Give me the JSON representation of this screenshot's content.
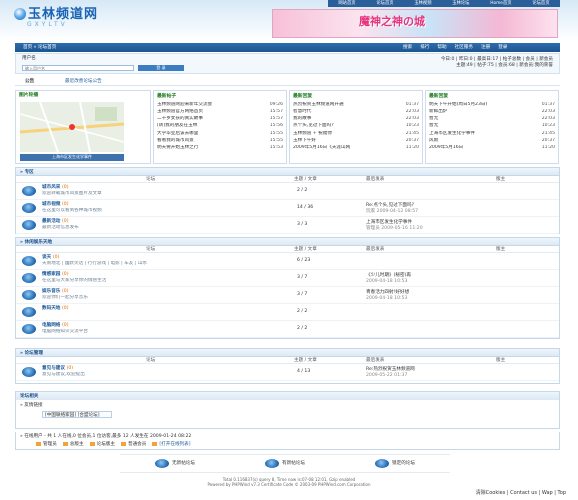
{
  "logo": {
    "text": "玉林频道网",
    "sub": "GXYLTV"
  },
  "topnav": [
    "网站首页",
    "论坛首页",
    "玉林视频",
    "玉林论坛",
    "Home首页",
    "论坛首页"
  ],
  "banner": {
    "text": "魔神之神の城"
  },
  "nav": {
    "left": "首页 » 论坛首页",
    "right": [
      "搜索",
      "排行",
      "帮助",
      "社区服务",
      "注册",
      "登录"
    ]
  },
  "user": {
    "label": "用户名",
    "input_placeholder": "输入用户名",
    "btn": "登 录",
    "stats": [
      "今日:0 | 昨日:0 | 最高日:17 | 帖子总数 | 会员 | 新会员",
      "主题:49 | 帖子:75 | 会员:68 | 新会员:我的荣誉"
    ]
  },
  "notice": {
    "title": "公告",
    "content": "最近改善论坛公告"
  },
  "pic": {
    "title": "图片轮播",
    "caption": "上海市区发生化学事件"
  },
  "col2": {
    "title": "最新帖子",
    "rows": [
      [
        "玉林频道网迎来新年交流会",
        "09:26"
      ],
      [
        "玉林频道官方网络首页",
        "15:57"
      ],
      [
        "二十岁女孩的真实故事",
        "15:57"
      ],
      [
        "[转]我的朋友在玉林",
        "15:56"
      ],
      [
        "大学毕业后该去哪里",
        "15:55"
      ],
      [
        "看看我的城市风景",
        "15:55"
      ],
      [
        "明天要开始玉林之行",
        "15:53"
      ]
    ]
  },
  "col3": {
    "title": "最新回复",
    "rows": [
      [
        "热烈祝贺玉林频道网开通",
        "01:37"
      ],
      [
        "智慧时代",
        "22:03"
      ],
      [
        "我的故事",
        "22:03"
      ],
      [
        "点个头,见过下面吗?",
        "10:23"
      ],
      [
        "玉林频道 + 祝福你",
        "21:45"
      ],
      [
        "玉林下午好",
        "20:37"
      ],
      [
        "2009年5月16日《天涯山网",
        "11:20"
      ]
    ]
  },
  "col4": {
    "title": "最新回复",
    "rows": [
      [
        "明天下午开始(周日5月23日)",
        "01:37"
      ],
      [
        "新鲜出炉",
        "22:03"
      ],
      [
        "暂无",
        "22:03"
      ],
      [
        "暂无",
        "10:23"
      ],
      [
        "上海市区发生化学事件",
        "21:45"
      ],
      [
        "风雨",
        "20:37"
      ],
      [
        "2009年5月16日",
        "11:20"
      ]
    ]
  },
  "sec1": {
    "title": "» 专区",
    "cols": [
      "论坛",
      "主题 / 文章",
      "最后发表",
      "版主"
    ],
    "rows": [
      {
        "name": "城市风采",
        "new": "(0)",
        "desc": "欢迎转载城市风景图片及文章",
        "stats": "2 / 2",
        "last": "",
        "lastsub": ""
      },
      {
        "name": "城市视频",
        "new": "(0)",
        "desc": "在这里可以看到各种城市视频",
        "stats": "14 / 36",
        "last": "Re:点个头,见过下面吗?",
        "lastsub": "玩家 2009-04-12 08:57"
      },
      {
        "name": "最新活动",
        "new": "(0)",
        "desc": "最新活动信息发布",
        "stats": "3 / 3",
        "last": "上海市区发生化学事件",
        "lastsub": "管理员 2009-05-16 11:20"
      }
    ]
  },
  "sec2": {
    "title": "» 休闲娱乐天地",
    "cols": [
      "论坛",
      "主题 / 文章",
      "最后发表",
      "版主"
    ],
    "rows": [
      {
        "name": "谈天",
        "new": "(0)",
        "desc": "天南地北 | 幽默笑话 | 行行游戏 | 电影 | 车友 | 山水",
        "stats": "6 / 23",
        "last": "",
        "lastsub": ""
      },
      {
        "name": "情感家园",
        "new": "(0)",
        "desc": "在这里与大家分享你的情感生活",
        "stats": "3 / 7",
        "last": "《少儿时期》(秘密)再",
        "lastsub": "2009-04-18 10:53"
      },
      {
        "name": "娱乐音乐",
        "new": "(0)",
        "desc": "欢迎你们一起分享音乐",
        "stats": "3 / 7",
        "last": "青春活力四射!好好想",
        "lastsub": "2009-04-18 10:53"
      },
      {
        "name": "数码天地",
        "new": "(0)",
        "desc": "",
        "stats": "2 / 2",
        "last": "",
        "lastsub": ""
      },
      {
        "name": "电脑网络",
        "new": "(0)",
        "desc": "电脑网络知识交流平台",
        "stats": "2 / 2",
        "last": "",
        "lastsub": ""
      }
    ]
  },
  "sec3": {
    "title": "» 论坛管理",
    "cols": [
      "论坛",
      "主题 / 文章",
      "最后发表",
      "版主"
    ],
    "rows": [
      {
        "name": "意见与建议",
        "new": "(0)",
        "desc": "意见与建议,欢迎提出",
        "stats": "4 / 13",
        "last": "Re:热烈祝贺玉林频道网",
        "lastsub": "2009-05-22 01:37"
      }
    ]
  },
  "links": {
    "title": "论坛相关",
    "sub": "» 友情链接",
    "box": "[中国联络家园] [合盟论坛]"
  },
  "online": {
    "title": "» 在线用户 - 共 1 人在线,0 位会员,1 位访客,最多 12 人发生在 2009-01-24 08:22",
    "legend": [
      "管理员",
      "总版主",
      "论坛版主",
      "普通会员",
      "[打开在线列表]"
    ]
  },
  "footer": {
    "buttons": [
      "无新帖论坛",
      "有新帖论坛",
      "锁定的论坛"
    ]
  },
  "copyright": [
    "Total 0.116837(s) query 8, Time now is:07-08 12:01, Gzip enabled",
    "Powered by PHPWind v7.3 Certificate Code © 2003-09 PHPWind.com Corporation"
  ],
  "bottom": "清除Cookies | Contact us | Wap | Top"
}
